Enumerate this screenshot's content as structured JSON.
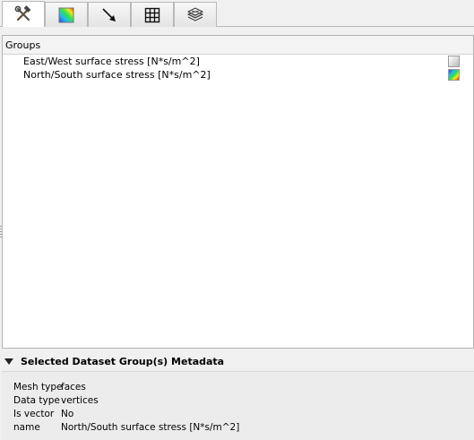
{
  "tabs": [
    {
      "icon": "hammer-wrench-icon",
      "active": true
    },
    {
      "icon": "color-ramp-icon",
      "active": false
    },
    {
      "icon": "vector-arrow-icon",
      "active": false
    },
    {
      "icon": "mesh-grid-icon",
      "active": false
    },
    {
      "icon": "layer-stack-icon",
      "active": false
    }
  ],
  "groups": {
    "header": "Groups",
    "items": [
      {
        "label": "East/West surface stress [N*s/m^2]",
        "ramp_icon": "gray-ramp-icon"
      },
      {
        "label": "North/South surface stress [N*s/m^2]",
        "ramp_icon": "color-ramp-icon"
      }
    ]
  },
  "metadata": {
    "title": "Selected Dataset Group(s) Metadata",
    "rows": [
      {
        "key": "Mesh type",
        "value": "faces"
      },
      {
        "key": "Data type",
        "value": "vertices"
      },
      {
        "key": "Is vector",
        "value": "No"
      },
      {
        "key": "name",
        "value": "North/South surface stress [N*s/m^2]"
      }
    ]
  }
}
